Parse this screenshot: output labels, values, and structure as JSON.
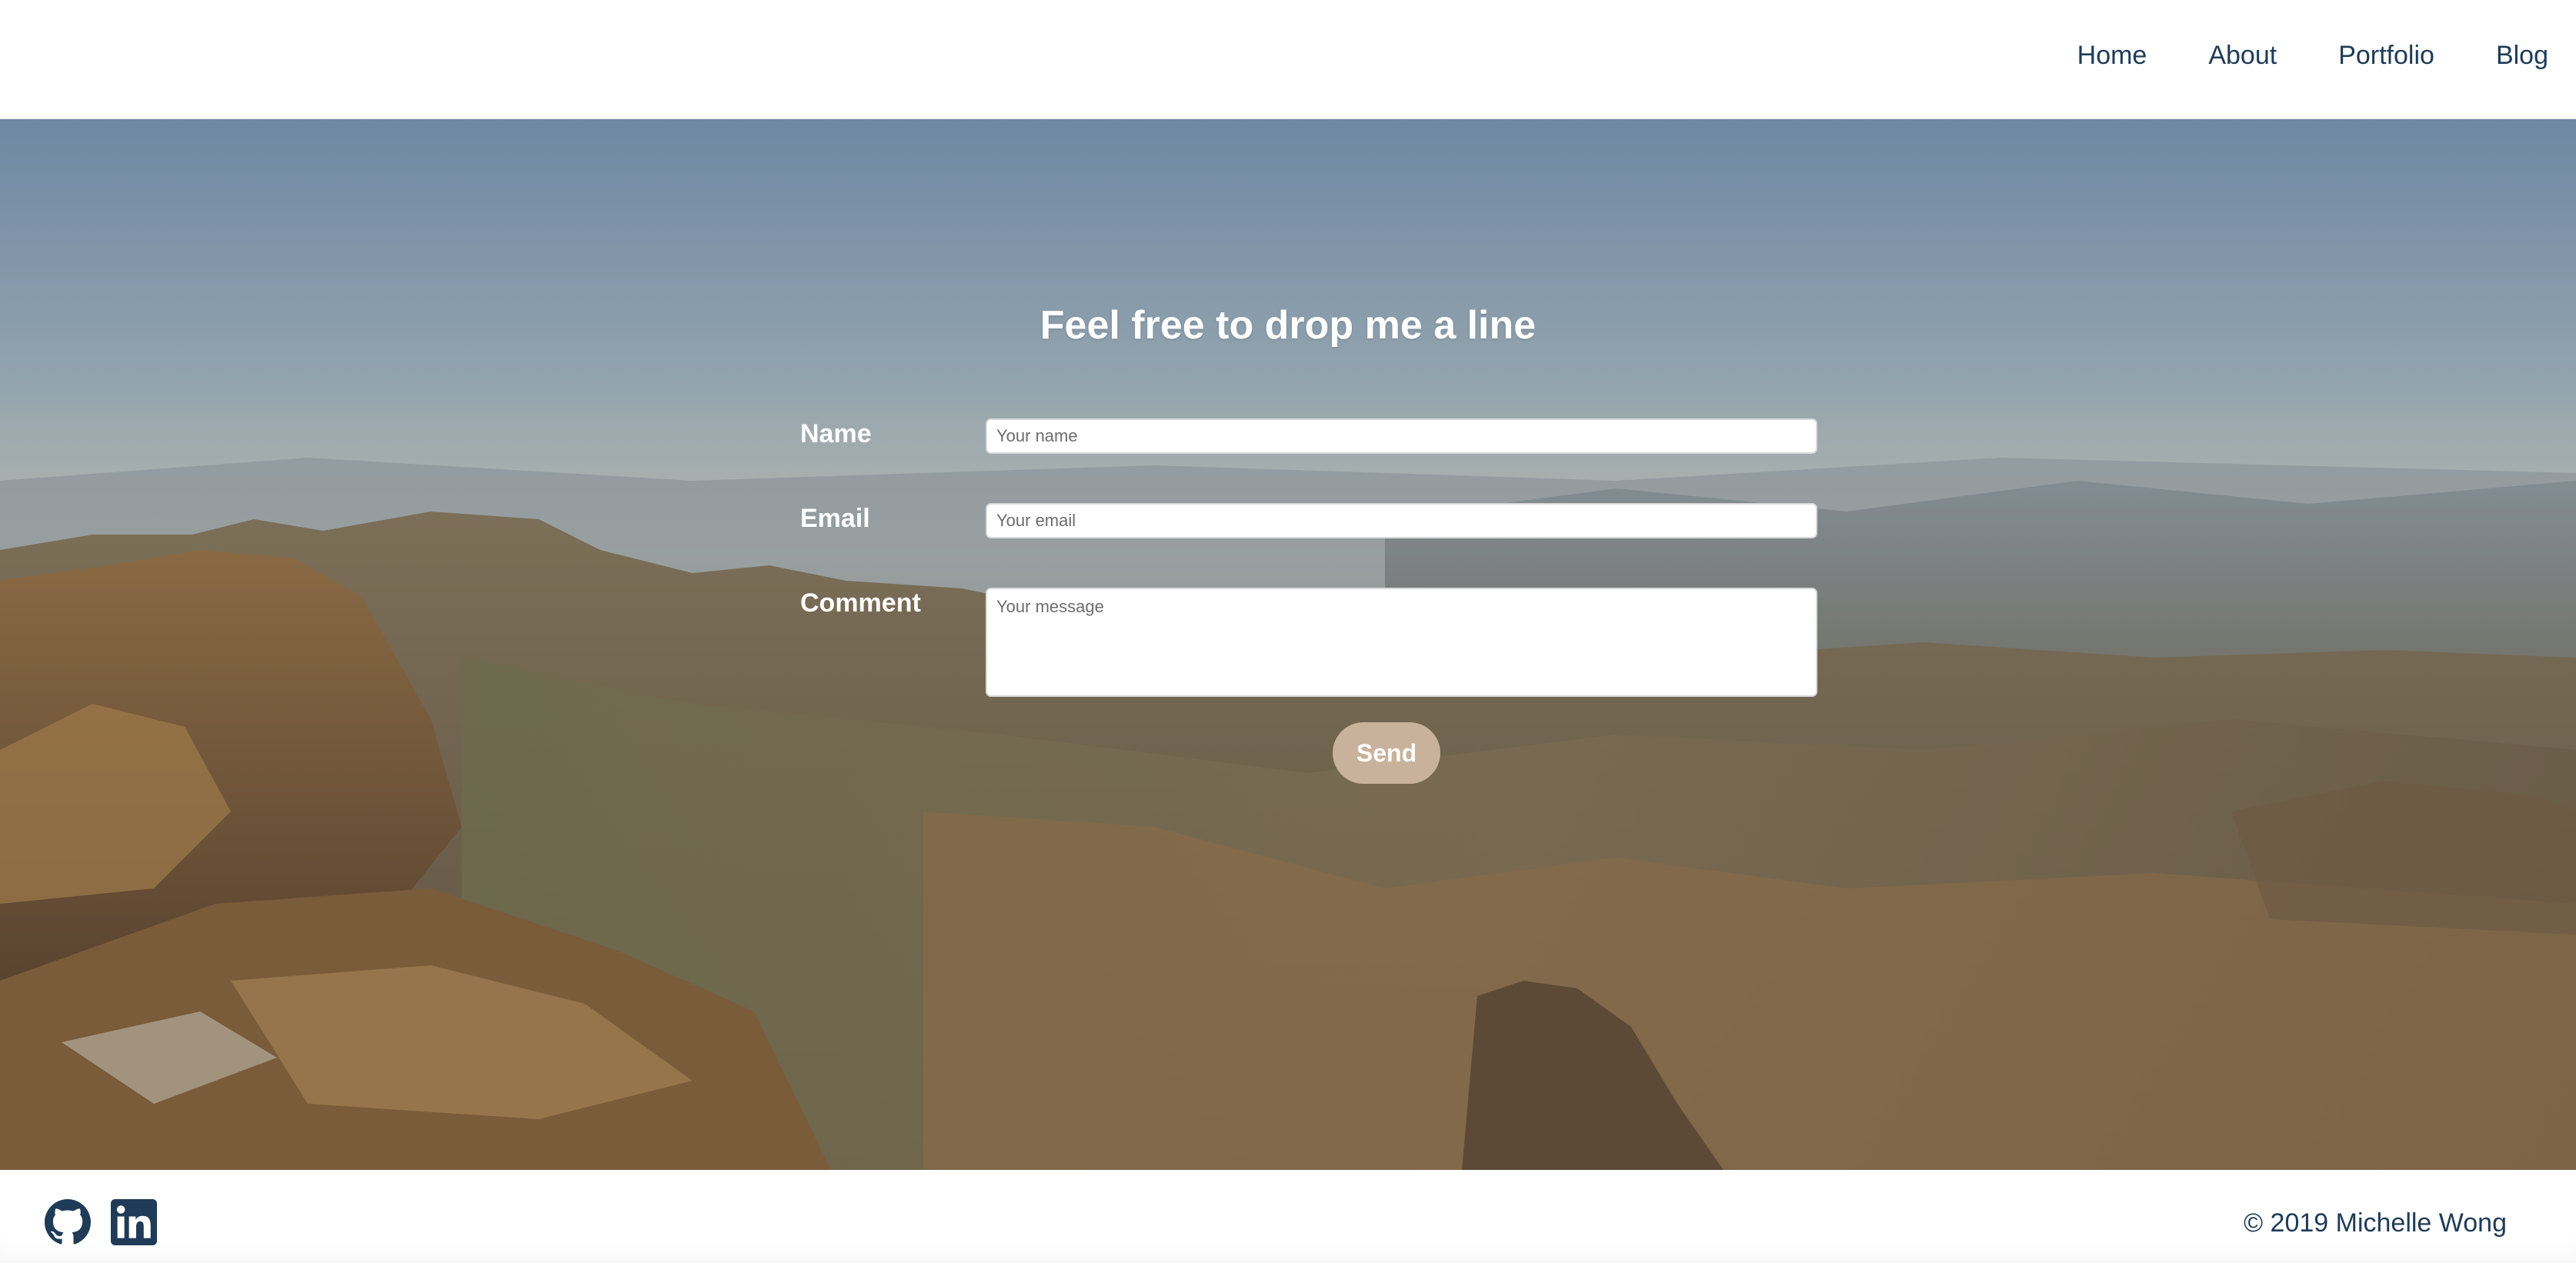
{
  "nav": {
    "items": [
      {
        "label": "Home"
      },
      {
        "label": "About"
      },
      {
        "label": "Portfolio"
      },
      {
        "label": "Blog"
      }
    ]
  },
  "contact": {
    "heading": "Feel free to drop me a line",
    "name_label": "Name",
    "name_placeholder": "Your name",
    "email_label": "Email",
    "email_placeholder": "Your email",
    "comment_label": "Comment",
    "comment_placeholder": "Your message",
    "send_label": "Send"
  },
  "footer": {
    "social": [
      {
        "icon": "github-icon"
      },
      {
        "icon": "linkedin-icon"
      }
    ],
    "copyright": "© 2019 Michelle Wong"
  },
  "colors": {
    "nav_text": "#1f3b57",
    "send_button": "#c8b29b",
    "icon": "#1f3b57"
  }
}
